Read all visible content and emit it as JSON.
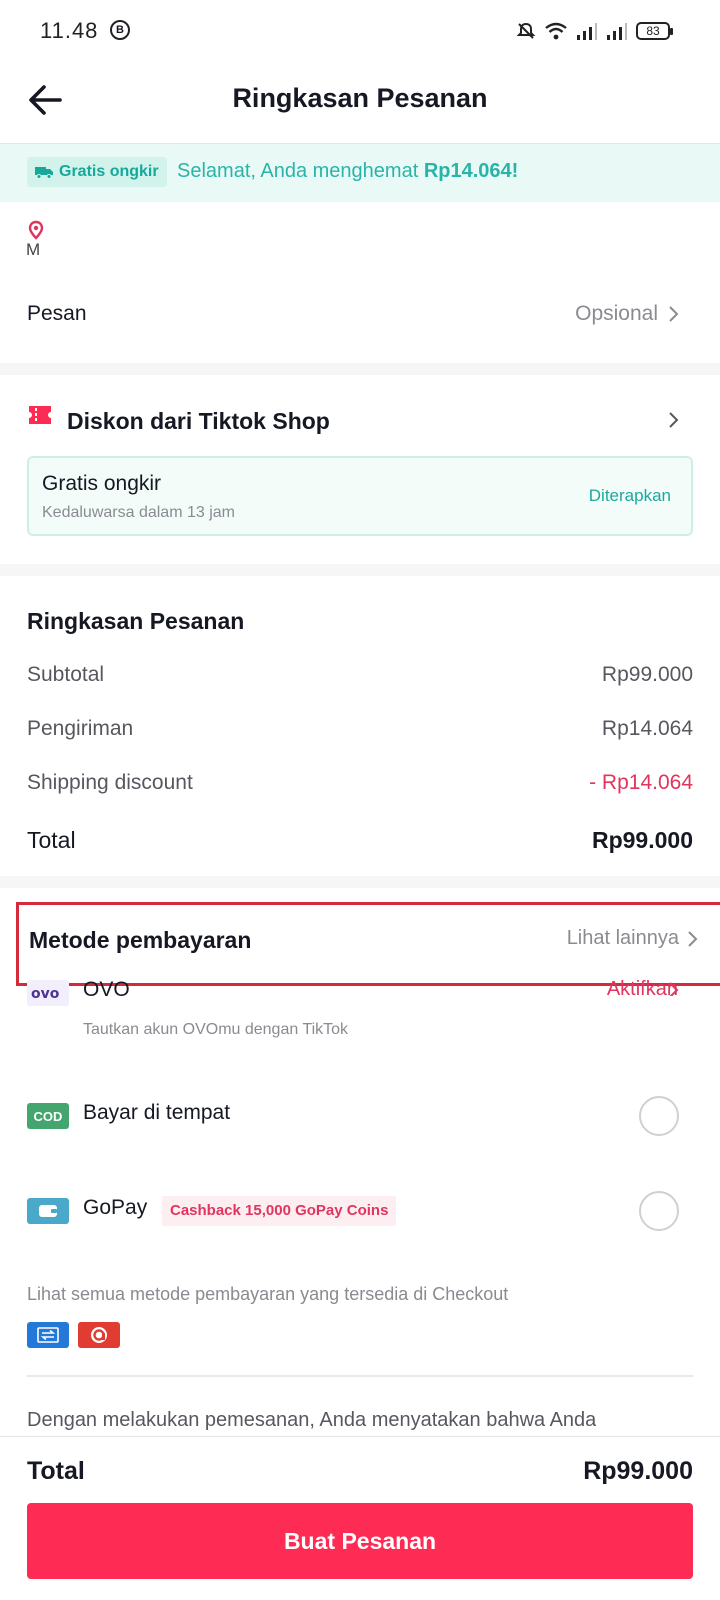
{
  "status_bar": {
    "time": "11.48",
    "b_badge": "B",
    "battery": "83"
  },
  "header": {
    "title": "Ringkasan Pesanan"
  },
  "banner": {
    "tag": "Gratis ongkir",
    "text_prefix": "Selamat, Anda menghemat ",
    "amount": "Rp14.064!"
  },
  "address": {
    "fragment": "M"
  },
  "message_row": {
    "label": "Pesan",
    "value": "Opsional"
  },
  "discount": {
    "title": "Diskon dari Tiktok Shop",
    "voucher_title": "Gratis ongkir",
    "voucher_sub": "Kedaluwarsa dalam 13 jam",
    "voucher_status": "Diterapkan"
  },
  "summary": {
    "title": "Ringkasan Pesanan",
    "rows": [
      {
        "label": "Subtotal",
        "value": "Rp99.000"
      },
      {
        "label": "Pengiriman",
        "value": "Rp14.064"
      },
      {
        "label": "Shipping discount",
        "value": "- Rp14.064"
      }
    ],
    "total_label": "Total",
    "total_value": "Rp99.000"
  },
  "payment": {
    "title": "Metode pembayaran",
    "more": "Lihat lainnya",
    "ovo": {
      "logo": "ovo",
      "name": "OVO",
      "action": "Aktifkan",
      "sub": "Tautkan akun OVOmu dengan TikTok"
    },
    "cod": {
      "icon": "COD",
      "name": "Bayar di tempat"
    },
    "gopay": {
      "name": "GoPay",
      "badge": "Cashback 15,000 GoPay Coins"
    },
    "see_all": "Lihat semua metode pembayaran yang tersedia di Checkout"
  },
  "terms": "Dengan melakukan pemesanan, Anda menyatakan bahwa Anda",
  "bottom": {
    "total_label": "Total",
    "total_value": "Rp99.000",
    "button": "Buat Pesanan"
  },
  "colors": {
    "accent": "#fe2c55",
    "teal": "#2ab4a8",
    "highlight_border": "#d32b3a"
  }
}
